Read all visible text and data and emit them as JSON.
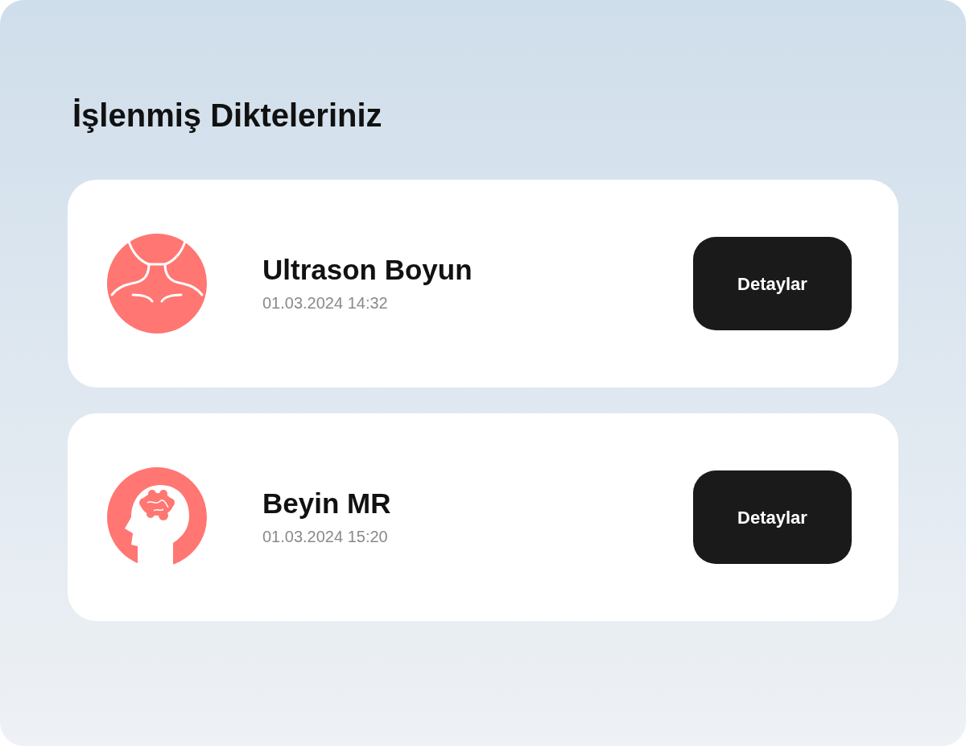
{
  "title": "İşlenmiş Dikteleriniz",
  "items": [
    {
      "kind": "neck",
      "name": "Ultrason Boyun",
      "date": "01.03.2024 14:32",
      "button": "Detaylar"
    },
    {
      "kind": "brain",
      "name": "Beyin MR",
      "date": "01.03.2024 15:20",
      "button": "Detaylar"
    }
  ]
}
